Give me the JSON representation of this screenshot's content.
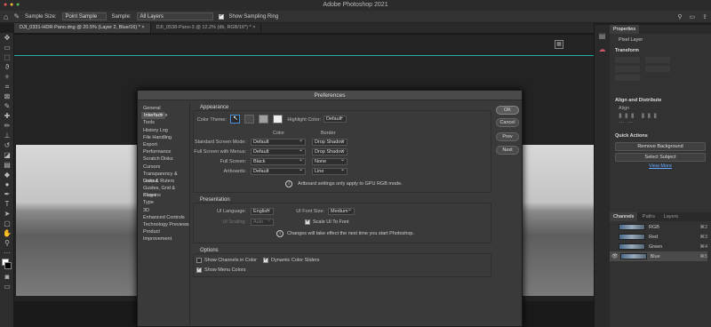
{
  "app_title": "Adobe Photoshop 2021",
  "options_bar": {
    "sample_size_label": "Sample Size:",
    "sample_size_value": "Point Sample",
    "sample_label": "Sample:",
    "sample_value": "All Layers",
    "sampling_ring_label": "Show Sampling Ring"
  },
  "doc_tabs": [
    {
      "label": "DJI_0331-HDR-Pano.dng @ 20.5% (Layer 2, Blue/16) *"
    },
    {
      "label": "DJI_0538-Pano-3 @ 12.2% (db, RGB/16*) *"
    }
  ],
  "right_panel": {
    "tab_properties": "Properties",
    "pixel_layer": "Pixel Layer",
    "transform": "Transform",
    "align_distribute": "Align and Distribute",
    "align": "Align",
    "quick_actions": "Quick Actions",
    "remove_bg": "Remove Background",
    "select_subject": "Select Subject",
    "view_more": "View More",
    "tabs": [
      "Channels",
      "Paths",
      "Layers"
    ],
    "channels": [
      {
        "name": "RGB",
        "shortcut": "⌘2"
      },
      {
        "name": "Red",
        "shortcut": "⌘3"
      },
      {
        "name": "Green",
        "shortcut": "⌘4"
      },
      {
        "name": "Blue",
        "shortcut": "⌘5"
      }
    ]
  },
  "dialog": {
    "title": "Preferences",
    "nav": [
      "General",
      "Interface",
      "Workspace",
      "Tools",
      "History Log",
      "File Handling",
      "Export",
      "Performance",
      "Scratch Disks",
      "Cursors",
      "Transparency & Gamut",
      "Units & Rulers",
      "Guides, Grid & Slices",
      "Plug-ins",
      "Type",
      "3D",
      "Enhanced Controls",
      "Technology Previews",
      "Product Improvement"
    ],
    "buttons": {
      "ok": "OK",
      "cancel": "Cancel",
      "prev": "Prev",
      "next": "Next"
    },
    "appearance": {
      "title": "Appearance",
      "color_theme": "Color Theme:",
      "highlight_color": "Highlight Color:",
      "highlight_value": "Default",
      "col_color": "Color",
      "col_border": "Border",
      "rows": [
        {
          "label": "Standard Screen Mode:",
          "color": "Default",
          "border": "Drop Shadow"
        },
        {
          "label": "Full Screen with Menus:",
          "color": "Default",
          "border": "Drop Shadow"
        },
        {
          "label": "Full Screen:",
          "color": "Black",
          "border": "None"
        },
        {
          "label": "Artboards:",
          "color": "Default",
          "border": "Line"
        }
      ],
      "note": "Artboard settings only apply to GPU RGB mode."
    },
    "presentation": {
      "title": "Presentation",
      "ui_language": "UI Language:",
      "ui_language_value": "English",
      "ui_font_size": "UI Font Size:",
      "ui_font_size_value": "Medium",
      "ui_scaling": "UI Scaling:",
      "ui_scaling_value": "Auto",
      "scale_ui_font": "Scale UI To Font",
      "note": "Changes will take effect the next time you start Photoshop."
    },
    "options": {
      "title": "Options",
      "show_channels_color": "Show Channels in Color",
      "dynamic_color_sliders": "Dynamic Color Sliders",
      "show_menu_colors": "Show Menu Colors"
    }
  }
}
